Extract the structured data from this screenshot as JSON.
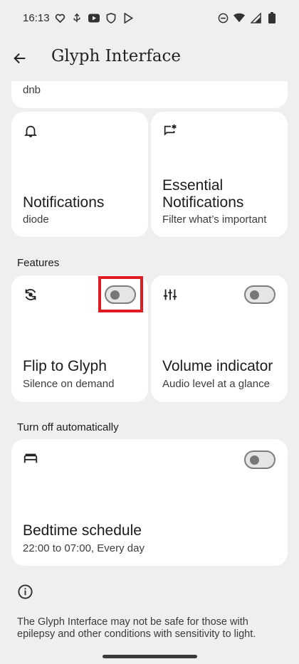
{
  "status": {
    "time": "16:13",
    "left_icons": [
      "heart-chat-icon",
      "usb-icon",
      "youtube-icon",
      "shield-icon",
      "play-store-icon"
    ],
    "right_icons": [
      "dnd-icon",
      "wifi-icon",
      "signal-icon",
      "battery-icon"
    ]
  },
  "appbar": {
    "title": "Glyph Interface"
  },
  "top_card": {
    "subtitle": "dnb"
  },
  "grid1": [
    {
      "icon": "bell-icon",
      "title": "Notifications",
      "subtitle": "diode"
    },
    {
      "icon": "essential-notification-icon",
      "title": "Essential Notifications",
      "subtitle": "Filter what’s important"
    }
  ],
  "features": {
    "header": "Features",
    "cards": [
      {
        "icon": "flip-icon",
        "title": "Flip to Glyph",
        "subtitle": "Silence on demand",
        "toggle_on": false
      },
      {
        "icon": "sliders-icon",
        "title": "Volume indicator",
        "subtitle": "Audio level at a glance",
        "toggle_on": false
      }
    ]
  },
  "auto_off": {
    "header": "Turn off automatically",
    "card": {
      "icon": "bed-icon",
      "title": "Bedtime schedule",
      "subtitle": "22:00 to 07:00, Every day",
      "toggle_on": false
    }
  },
  "info": {
    "icon": "info-icon",
    "text": "The Glyph Interface may not be safe for those with epilepsy and other conditions with sensitivity to light."
  },
  "colors": {
    "highlight": "#e11b22",
    "card": "#ffffff",
    "background": "#efefef"
  }
}
